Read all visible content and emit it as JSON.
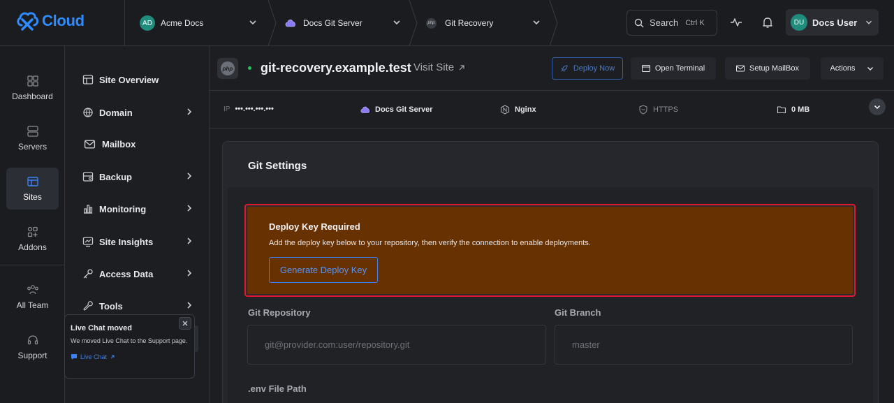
{
  "brand": {
    "name": "Cloud",
    "accent": "#2f8cff"
  },
  "breadcrumbs": [
    {
      "label": "Acme Docs",
      "avatar": "AD"
    },
    {
      "label": "Docs Git Server",
      "icon": "cloud-icon"
    },
    {
      "label": "Git Recovery",
      "icon": "php-icon"
    }
  ],
  "search": {
    "label": "Search",
    "shortcut": "Ctrl K"
  },
  "user": {
    "initials": "DU",
    "name": "Docs User"
  },
  "rail": {
    "items": [
      {
        "label": "Dashboard"
      },
      {
        "label": "Servers"
      },
      {
        "label": "Sites"
      },
      {
        "label": "Addons"
      },
      {
        "label": "All Team"
      },
      {
        "label": "Support"
      }
    ]
  },
  "sitenav": {
    "items": [
      {
        "label": "Site Overview"
      },
      {
        "label": "Domain"
      },
      {
        "label": "Mailbox"
      },
      {
        "label": "Backup"
      },
      {
        "label": "Monitoring"
      },
      {
        "label": "Site Insights"
      },
      {
        "label": "Access Data"
      },
      {
        "label": "Tools"
      }
    ]
  },
  "popup": {
    "title": "Live Chat moved",
    "text": "We moved Live Chat to the Support page.",
    "link": "Live Chat"
  },
  "site": {
    "php_label": "php",
    "domain": "git-recovery.example.test",
    "visit_label": "Visit Site",
    "status_color": "#22c55e"
  },
  "header_buttons": {
    "deploy": "Deploy Now",
    "terminal": "Open Terminal",
    "mailbox": "Setup MailBox",
    "actions": "Actions"
  },
  "info": {
    "ip_label": "IP",
    "ip_value": "•••.•••.•••.•••",
    "server": "Docs Git Server",
    "webserver": "Nginx",
    "https": "HTTPS",
    "storage": "0 MB"
  },
  "git": {
    "title": "Git Settings",
    "alert_title": "Deploy Key Required",
    "alert_text": "Add the deploy key below to your repository, then verify the connection to enable deployments.",
    "alert_button": "Generate Deploy Key",
    "repo_label": "Git Repository",
    "repo_placeholder": "git@provider.com:user/repository.git",
    "branch_label": "Git Branch",
    "branch_placeholder": "master",
    "env_label": ".env File Path"
  }
}
